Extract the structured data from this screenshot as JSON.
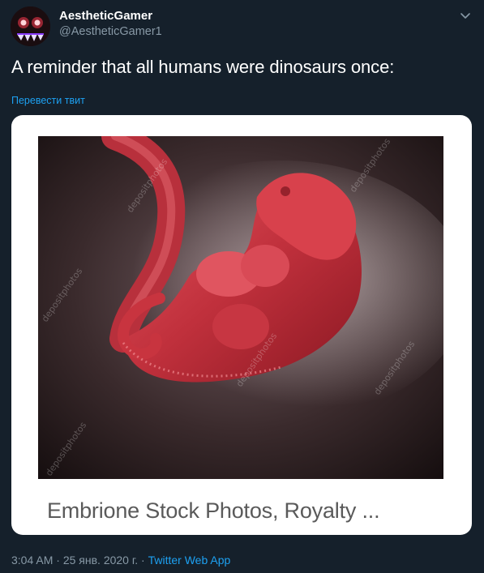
{
  "author": {
    "display_name": "AestheticGamer",
    "handle": "@AestheticGamer1",
    "avatar_icon": "glowing-eyes-avatar"
  },
  "tweet": {
    "text": "A reminder that all humans were dinosaurs once:",
    "translate_label": "Перевести твит"
  },
  "card": {
    "caption": "Embrione Stock Photos, Royalty ...",
    "image_subject": "red embryo render",
    "watermark": "depositphotos"
  },
  "meta": {
    "time": "3:04 AM",
    "separator": "·",
    "date": "25 янв. 2020 г.",
    "source": "Twitter Web App"
  },
  "colors": {
    "background": "#15202b",
    "secondary_text": "#8899a6",
    "link": "#1da1f2",
    "card_background": "#ffffff",
    "caption_text": "#5a5a5a"
  }
}
